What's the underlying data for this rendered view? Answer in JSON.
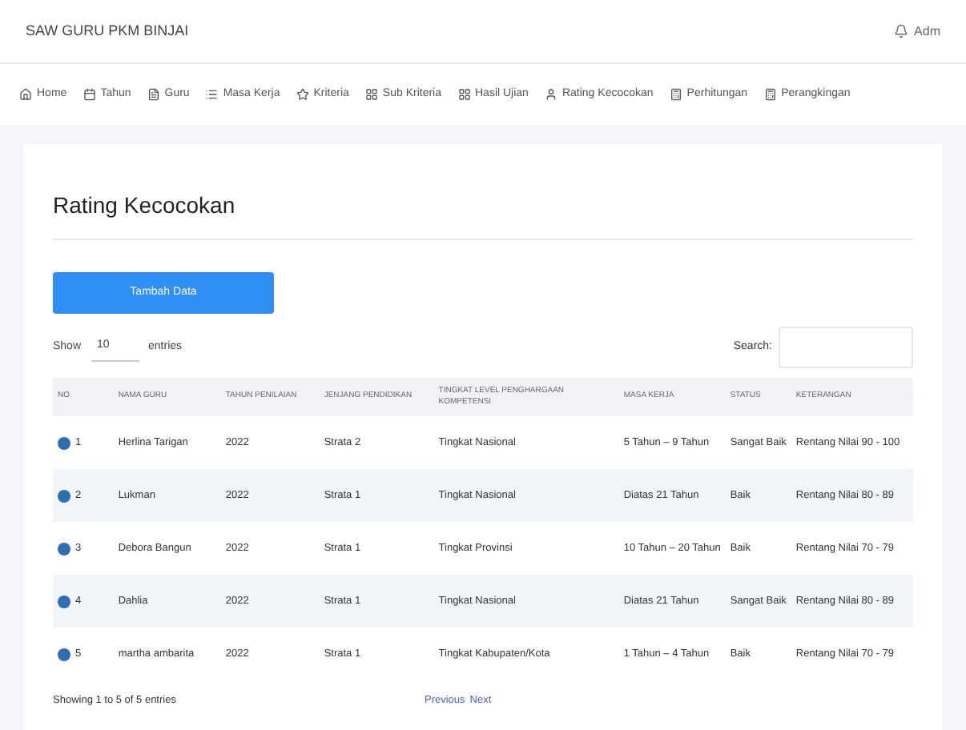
{
  "app_title": "SAW GURU PKM BINJAI",
  "user": "Adm",
  "nav": [
    "Home",
    "Tahun",
    "Guru",
    "Masa Kerja",
    "Kriteria",
    "Sub Kriteria",
    "Hasil Ujian",
    "Rating Kecocokan",
    "Perhitungan",
    "Perangkingan"
  ],
  "page_title": "Rating Kecocokan",
  "add_button": "Tambah Data",
  "length": {
    "show": "Show",
    "value": "10",
    "entries": "entries"
  },
  "search": {
    "label": "Search:"
  },
  "table": {
    "columns": [
      "NO",
      "NAMA GURU",
      "TAHUN PENILAIAN",
      "JENJANG PENDIDIKAN",
      "TINGKAT LEVEL PENGHARGAAN KOMPETENSI",
      "MASA KERJA",
      "STATUS",
      "KETERANGAN"
    ],
    "rows": [
      [
        "1",
        "Herlina Tarigan",
        "2022",
        "Strata 2",
        "Tingkat Nasional",
        "5 Tahun – 9 Tahun",
        "Sangat Baik",
        "Rentang Nilai 90 - 100"
      ],
      [
        "2",
        "Lukman",
        "2022",
        "Strata 1",
        "Tingkat Nasional",
        "Diatas 21 Tahun",
        "Baik",
        "Rentang Nilai 80 - 89"
      ],
      [
        "3",
        "Debora Bangun",
        "2022",
        "Strata 1",
        "Tingkat Provinsi",
        "10 Tahun – 20 Tahun",
        "Baik",
        "Rentang Nilai 70 - 79"
      ],
      [
        "4",
        "Dahlia",
        "2022",
        "Strata 1",
        "Tingkat Nasional",
        "Diatas 21 Tahun",
        "Sangat Baik",
        "Rentang Nilai 80 - 89"
      ],
      [
        "5",
        "martha ambarita",
        "2022",
        "Strata 1",
        "Tingkat Kabupaten/Kota",
        "1 Tahun – 4 Tahun",
        "Baik",
        "Rentang Nilai 70 - 79"
      ]
    ]
  },
  "info": "Showing 1 to 5 of 5 entries",
  "pagination": [
    "Previous",
    "Next"
  ]
}
